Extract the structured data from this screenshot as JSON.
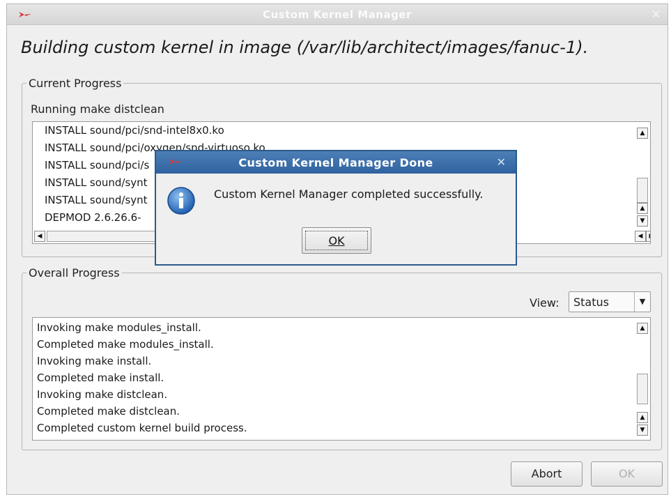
{
  "window": {
    "title": "Custom Kernel Manager",
    "close_glyph": "✕"
  },
  "heading": "Building custom kernel in image (/var/lib/architect/images/fanuc-1).",
  "current_progress": {
    "legend": "Current Progress",
    "status": "Running make distclean",
    "lines": [
      "INSTALL sound/pci/snd-intel8x0.ko",
      "INSTALL sound/pci/oxygen/snd-virtuoso.ko",
      "INSTALL sound/pci/s",
      "INSTALL sound/synt",
      "INSTALL sound/synt",
      "DEPMOD  2.6.26.6-"
    ]
  },
  "overall_progress": {
    "legend": "Overall Progress",
    "view_label": "View:",
    "view_value": "Status",
    "lines": [
      "Invoking make modules_install.",
      "Completed make modules_install.",
      "Invoking make install.",
      "Completed make install.",
      "Invoking make distclean.",
      "Completed make distclean.",
      "Completed custom kernel build process."
    ]
  },
  "buttons": {
    "abort": "Abort",
    "ok": "OK"
  },
  "dialog": {
    "title": "Custom Kernel Manager Done",
    "message": "Custom Kernel Manager completed successfully.",
    "ok_label": "OK",
    "close_glyph": "✕"
  },
  "colors": {
    "dialog_title_bar": "#3a6ca8",
    "info_icon": "#2c6fc0"
  }
}
